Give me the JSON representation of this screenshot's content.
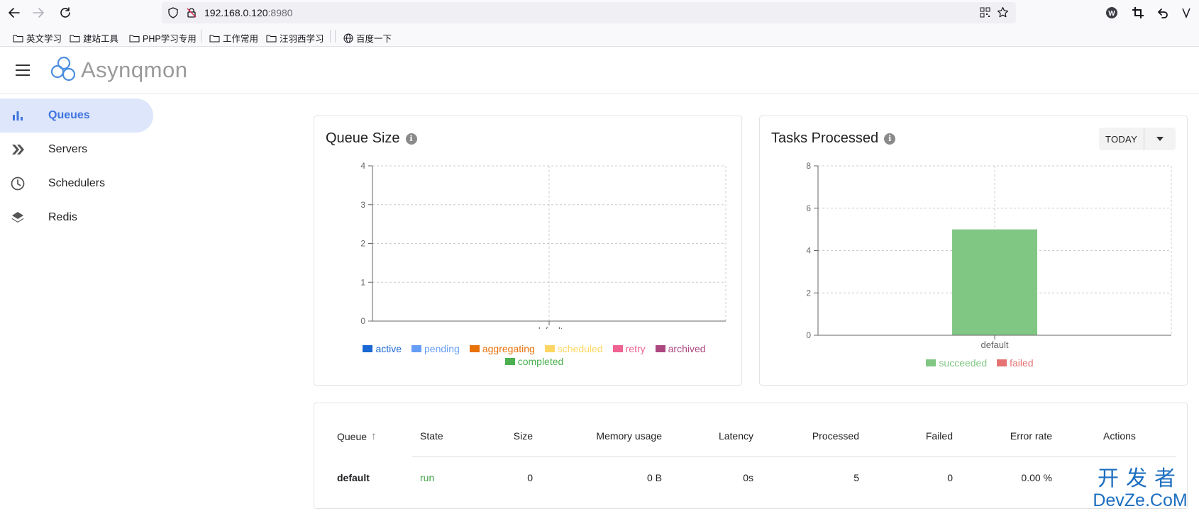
{
  "browser": {
    "url_host": "192.168.0.120",
    "url_port": ":8980",
    "bookmarks": [
      "英文学习",
      "建站工具",
      "PHP学习专用",
      "工作常用",
      "汪羽西学习",
      "百度一下"
    ]
  },
  "app": {
    "title": "Asynqmon"
  },
  "sidebar": {
    "items": [
      {
        "label": "Queues",
        "icon": "bar-chart-icon",
        "active": true
      },
      {
        "label": "Servers",
        "icon": "double-chevron-icon",
        "active": false
      },
      {
        "label": "Schedulers",
        "icon": "clock-icon",
        "active": false
      },
      {
        "label": "Redis",
        "icon": "layers-icon",
        "active": false
      }
    ]
  },
  "queue_size_card": {
    "title": "Queue Size",
    "info": "i"
  },
  "tasks_processed_card": {
    "title": "Tasks Processed",
    "info": "i",
    "range_label": "TODAY"
  },
  "chart_data": [
    {
      "type": "bar",
      "categories": [
        "default"
      ],
      "series": [
        {
          "name": "active",
          "values": [
            0
          ],
          "color": "#1967d2"
        },
        {
          "name": "pending",
          "values": [
            0
          ],
          "color": "#669df6"
        },
        {
          "name": "aggregating",
          "values": [
            0
          ],
          "color": "#e8710a"
        },
        {
          "name": "scheduled",
          "values": [
            0
          ],
          "color": "#fdd663"
        },
        {
          "name": "retry",
          "values": [
            0
          ],
          "color": "#f06292"
        },
        {
          "name": "archived",
          "values": [
            0
          ],
          "color": "#ac4780"
        },
        {
          "name": "completed",
          "values": [
            0
          ],
          "color": "#4caf50"
        }
      ],
      "yticks": [
        "0",
        "1",
        "2",
        "3",
        "4"
      ],
      "ylim": [
        0,
        4
      ],
      "grid": true,
      "legend": "bottom"
    },
    {
      "type": "bar",
      "categories": [
        "default"
      ],
      "series": [
        {
          "name": "succeeded",
          "values": [
            5
          ],
          "color": "#81c784"
        },
        {
          "name": "failed",
          "values": [
            0
          ],
          "color": "#e57373"
        }
      ],
      "yticks": [
        "0",
        "2",
        "4",
        "6",
        "8"
      ],
      "ylim": [
        0,
        8
      ],
      "grid": true,
      "legend": "bottom"
    }
  ],
  "table": {
    "headers": [
      "Queue",
      "State",
      "Size",
      "Memory usage",
      "Latency",
      "Processed",
      "Failed",
      "Error rate",
      "Actions"
    ],
    "sort_indicator": "↑",
    "rows": [
      [
        "default",
        "run",
        "0",
        "0 B",
        "0s",
        "5",
        "0",
        "0.00 %",
        ""
      ]
    ],
    "colors": {
      "state_run": "#43a047"
    }
  },
  "watermark": {
    "line1": "开发者",
    "line2": "DevZe.CoM"
  }
}
